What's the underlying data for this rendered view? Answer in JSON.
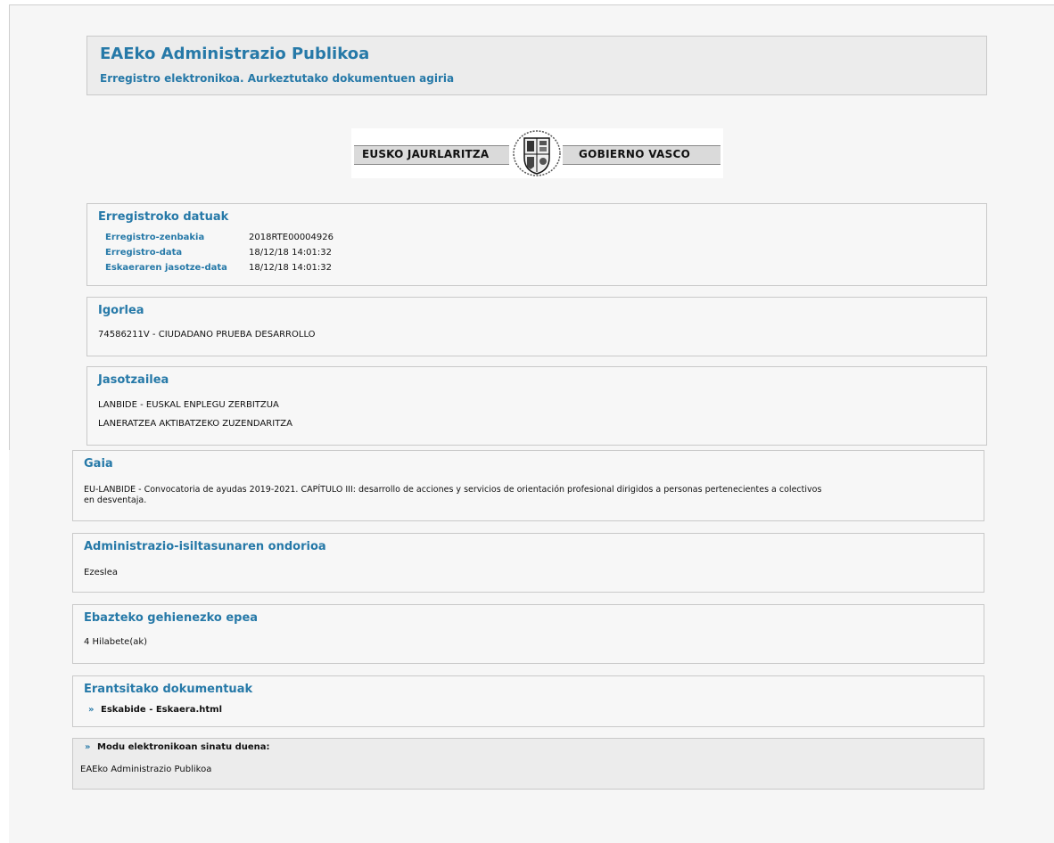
{
  "header": {
    "title": "EAEko Administrazio Publikoa",
    "subtitle": "Erregistro elektronikoa. Aurkeztutako dokumentuen agiria"
  },
  "logo": {
    "left_text": "EUSKO JAURLARITZA",
    "right_text": "GOBIERNO VASCO"
  },
  "registry": {
    "title": "Erregistroko datuak",
    "rows": [
      {
        "label": "Erregistro-zenbakia",
        "value": "2018RTE00004926"
      },
      {
        "label": "Erregistro-data",
        "value": "18/12/18 14:01:32"
      },
      {
        "label": "Eskaeraren jasotze-data",
        "value": "18/12/18 14:01:32"
      }
    ]
  },
  "sender": {
    "title": "Igorlea",
    "text": "74586211V - CIUDADANO PRUEBA DESARROLLO"
  },
  "recipient": {
    "title": "Jasotzailea",
    "line1": "LANBIDE - EUSKAL ENPLEGU ZERBITZUA",
    "line2": "LANERATZEA AKTIBATZEKO ZUZENDARITZA"
  },
  "subject": {
    "title": "Gaia",
    "line1": "EU-LANBIDE - Convocatoria de ayudas 2019-2021. CAPÍTULO III: desarrollo de acciones y servicios de orientación profesional dirigidos a personas pertenecientes a colectivos",
    "line2": "en desventaja."
  },
  "silence": {
    "title": "Administrazio-isiltasunaren ondorioa",
    "text": "Ezeslea"
  },
  "deadline": {
    "title": "Ebazteko gehienezko epea",
    "text": "4 Hilabete(ak)"
  },
  "documents": {
    "title": "Erantsitako dokumentuak",
    "marker": "»",
    "items": [
      "Eskabide - Eskaera.html"
    ]
  },
  "signature": {
    "marker": "»",
    "title": "Modu elektronikoan sinatu duena:",
    "text": "EAEko Administrazio Publikoa"
  },
  "colors": {
    "accent": "#2679a8",
    "panel": "#f6f6f6",
    "border": "#c9c9c9"
  }
}
